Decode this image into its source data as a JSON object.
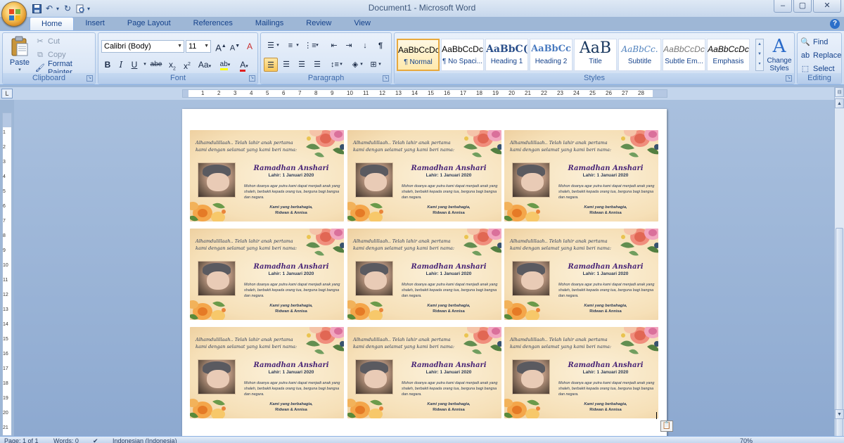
{
  "window": {
    "title": "Document1 - Microsoft Word",
    "minimize": "–",
    "maximize": "▢",
    "close": "✕"
  },
  "tabs": [
    "Home",
    "Insert",
    "Page Layout",
    "References",
    "Mailings",
    "Review",
    "View"
  ],
  "active_tab": "Home",
  "help": "?",
  "clipboard": {
    "paste_label": "Paste",
    "cut_label": "Cut",
    "copy_label": "Copy",
    "format_painter_label": "Format Painter",
    "group_label": "Clipboard"
  },
  "font": {
    "name": "Calibri (Body)",
    "size": "11",
    "group_label": "Font",
    "grow": "A",
    "shrink": "A",
    "clear": "A",
    "bold": "B",
    "italic": "I",
    "underline": "U",
    "strike": "abe",
    "subscript": "x",
    "superscript": "x",
    "change_case": "Aa",
    "highlight": "ab",
    "font_color": "A"
  },
  "paragraph": {
    "group_label": "Paragraph",
    "show_marks": "¶",
    "sort": "↓"
  },
  "styles": {
    "group_label": "Styles",
    "items": [
      {
        "sample": "AaBbCcDc",
        "name": "¶ Normal"
      },
      {
        "sample": "AaBbCcDc",
        "name": "¶ No Spaci..."
      },
      {
        "sample": "AaBbC(",
        "name": "Heading 1"
      },
      {
        "sample": "AaBbCc",
        "name": "Heading 2"
      },
      {
        "sample": "AaB",
        "name": "Title"
      },
      {
        "sample": "AaBbCc.",
        "name": "Subtitle"
      },
      {
        "sample": "AaBbCcDc",
        "name": "Subtle Em..."
      },
      {
        "sample": "AaBbCcDc",
        "name": "Emphasis"
      }
    ],
    "change_styles_label": "Change Styles",
    "change_styles_icon": "A"
  },
  "editing": {
    "group_label": "Editing",
    "find_label": "Find",
    "replace_label": "Replace",
    "select_label": "Select"
  },
  "ruler": {
    "ticks": [
      "1",
      "2",
      "3",
      "4",
      "5",
      "6",
      "7",
      "8",
      "9",
      "10",
      "11",
      "12",
      "13",
      "14",
      "15",
      "16",
      "17",
      "18",
      "19",
      "20",
      "21",
      "22",
      "23",
      "24",
      "25",
      "26",
      "27",
      "28"
    ],
    "vticks": [
      "1",
      "2",
      "3",
      "4",
      "5",
      "6",
      "7",
      "8",
      "9",
      "10",
      "11",
      "12",
      "13",
      "14",
      "15",
      "16",
      "17",
      "18",
      "19",
      "20",
      "21"
    ]
  },
  "card": {
    "intro": "Alhamdulillaah.. Telah lahir anak pertama kami dengan selamat yang kami beri nama:",
    "name": "Ramadhan Anshari",
    "born": "Lahir: 1 Januari 2020",
    "prayer": "Mohon doanya agar putra kami dapat menjadi anak yang shaleh, berbakti kepada orang tua, berguna bagi bangsa dan negara.",
    "sign1": "Kami yang berbahagia,",
    "sign2": "Ridwan & Annisa"
  },
  "status": {
    "page": "Page: 1 of 1",
    "words": "Words: 0",
    "language": "Indonesian (Indonesia)",
    "zoom": "70%"
  },
  "colors": {
    "accent": "#15428b",
    "name_purple": "#4a2677",
    "card_bg": "#f6e0b8"
  }
}
